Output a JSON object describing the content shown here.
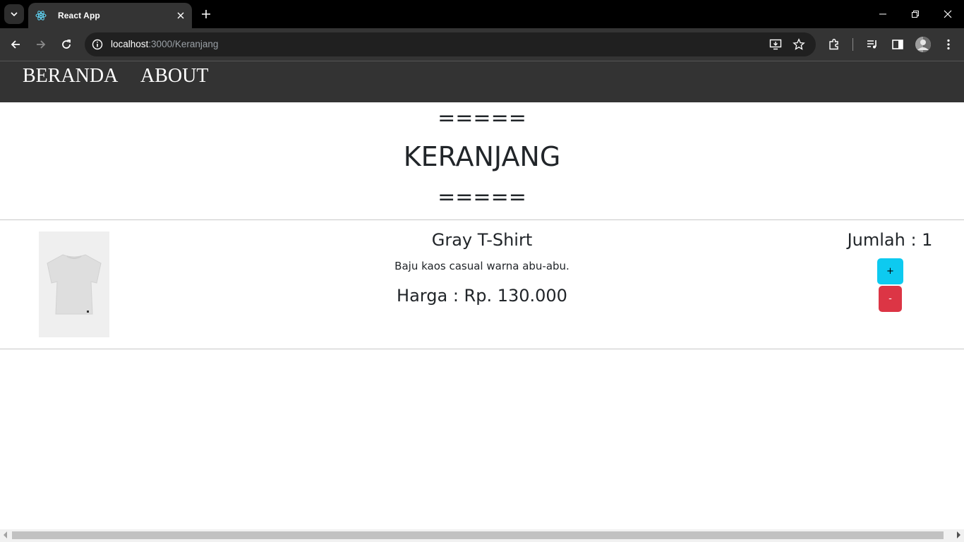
{
  "browser": {
    "tab_title": "React App",
    "url_host": "localhost",
    "url_path": ":3000/Keranjang",
    "icons": {
      "tab_list": "chevron-down-icon",
      "favicon": "react-icon",
      "close_tab": "close-icon",
      "new_tab": "plus-icon",
      "back": "arrow-left-icon",
      "forward": "arrow-right-icon",
      "reload": "reload-icon",
      "site_info": "info-icon",
      "install": "install-app-icon",
      "bookmark": "star-icon",
      "extensions": "puzzle-icon",
      "media": "media-controls-icon",
      "side_panel": "side-panel-icon",
      "menu": "kebab-menu-icon"
    }
  },
  "navbar": {
    "links": [
      {
        "label": "BERANDA"
      },
      {
        "label": "ABOUT"
      }
    ]
  },
  "header": {
    "divider_top": "=====",
    "title": "KERANJANG",
    "divider_bottom": "====="
  },
  "cart": {
    "items": [
      {
        "name": "Gray T-Shirt",
        "description": "Baju kaos casual warna abu-abu.",
        "price": "Harga : Rp. 130.000",
        "quantity": "Jumlah : 1",
        "plus_label": "+",
        "minus_label": "-"
      }
    ]
  },
  "colors": {
    "navbar_bg": "#333333",
    "plus_button": "#0dcaf0",
    "minus_button": "#dc3545",
    "text": "#212529"
  }
}
